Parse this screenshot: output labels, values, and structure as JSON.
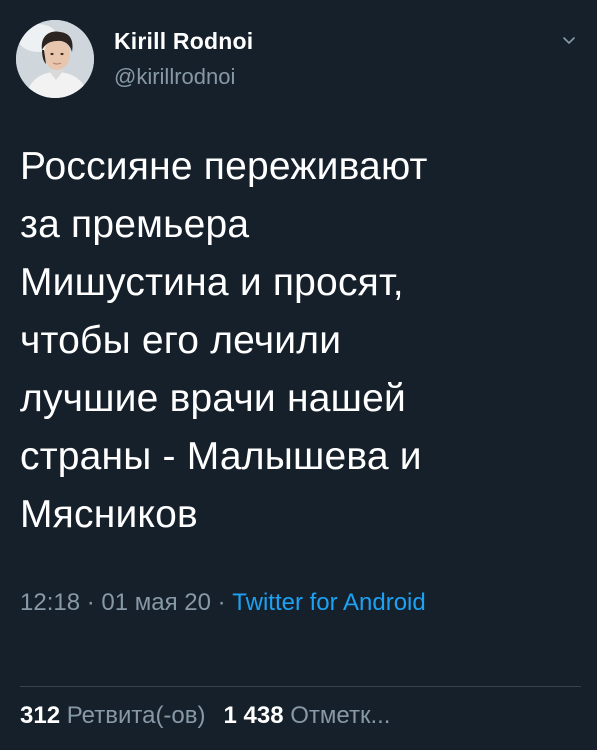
{
  "colors": {
    "background": "#15202b",
    "text_primary": "#ffffff",
    "text_secondary": "#8899a6",
    "link": "#1da1f2",
    "divider": "#38444d"
  },
  "author": {
    "display_name": "Kirill Rodnoi",
    "handle": "@kirillrodnoi",
    "avatar_icon": "user-avatar-photo"
  },
  "menu": {
    "icon": "chevron-down-icon"
  },
  "tweet": {
    "text": "Россияне переживают\nза премьера\nМишустина и просят,\nчтобы его лечили\nлучшие врачи нашей\nстраны - Малышева и\nМясников"
  },
  "meta": {
    "time": "12:18",
    "separator": " · ",
    "date": "01 мая 20",
    "source": "Twitter for Android"
  },
  "stats": {
    "retweets_count": "312",
    "retweets_label": "Ретвита(-ов)",
    "likes_count": "1 438",
    "likes_label": "Отметк..."
  }
}
